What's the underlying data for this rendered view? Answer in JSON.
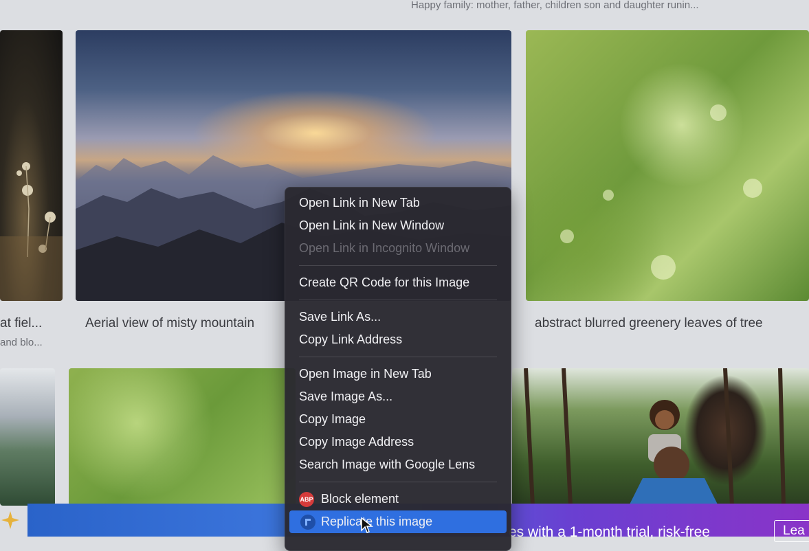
{
  "top_caption": "Happy family: mother, father, children son and daughter runin...",
  "row1": {
    "left_caption_line1": "at fiel...",
    "left_caption_line2": "and blo...",
    "mid_caption": "Aerial view of misty mountain",
    "right_caption": "abstract blurred greenery leaves of tree"
  },
  "banner": {
    "text": "es with a 1-month trial, risk-free",
    "button_label": "Lea"
  },
  "context_menu": {
    "group1": [
      "Open Link in New Tab",
      "Open Link in New Window",
      "Open Link in Incognito Window"
    ],
    "group2": [
      "Create QR Code for this Image"
    ],
    "group3": [
      "Save Link As...",
      "Copy Link Address"
    ],
    "group4": [
      "Open Image in New Tab",
      "Save Image As...",
      "Copy Image",
      "Copy Image Address",
      "Search Image with Google Lens"
    ],
    "extensions": [
      {
        "label": "Block element",
        "icon": "adblock-plus-icon",
        "icon_text": "ABP"
      },
      {
        "label": "Replicate this image",
        "icon": "replicate-icon",
        "icon_text": ""
      }
    ],
    "highlight_color": "#2f6fe0"
  }
}
